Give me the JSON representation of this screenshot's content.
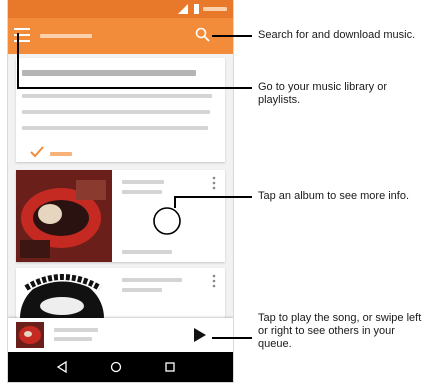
{
  "statusbar": {
    "time_placeholder": ""
  },
  "appbar": {
    "menu_icon": "hamburger-menu-icon",
    "search_icon": "search-icon",
    "colors": {
      "status": "#e8792b",
      "appbar": "#f28c3b",
      "accent": "#f28c3b"
    }
  },
  "callouts": {
    "search": "Search for and download music.",
    "library": "Go to your music library or playlists.",
    "album": "Tap an album to see more info.",
    "play": "Tap to play the song, or swipe left or right to see others in your queue."
  },
  "navbar": {
    "back_icon": "back-triangle-icon",
    "home_icon": "home-circle-icon",
    "recents_icon": "recents-square-icon"
  },
  "nowplaying": {
    "play_icon": "play-icon"
  }
}
